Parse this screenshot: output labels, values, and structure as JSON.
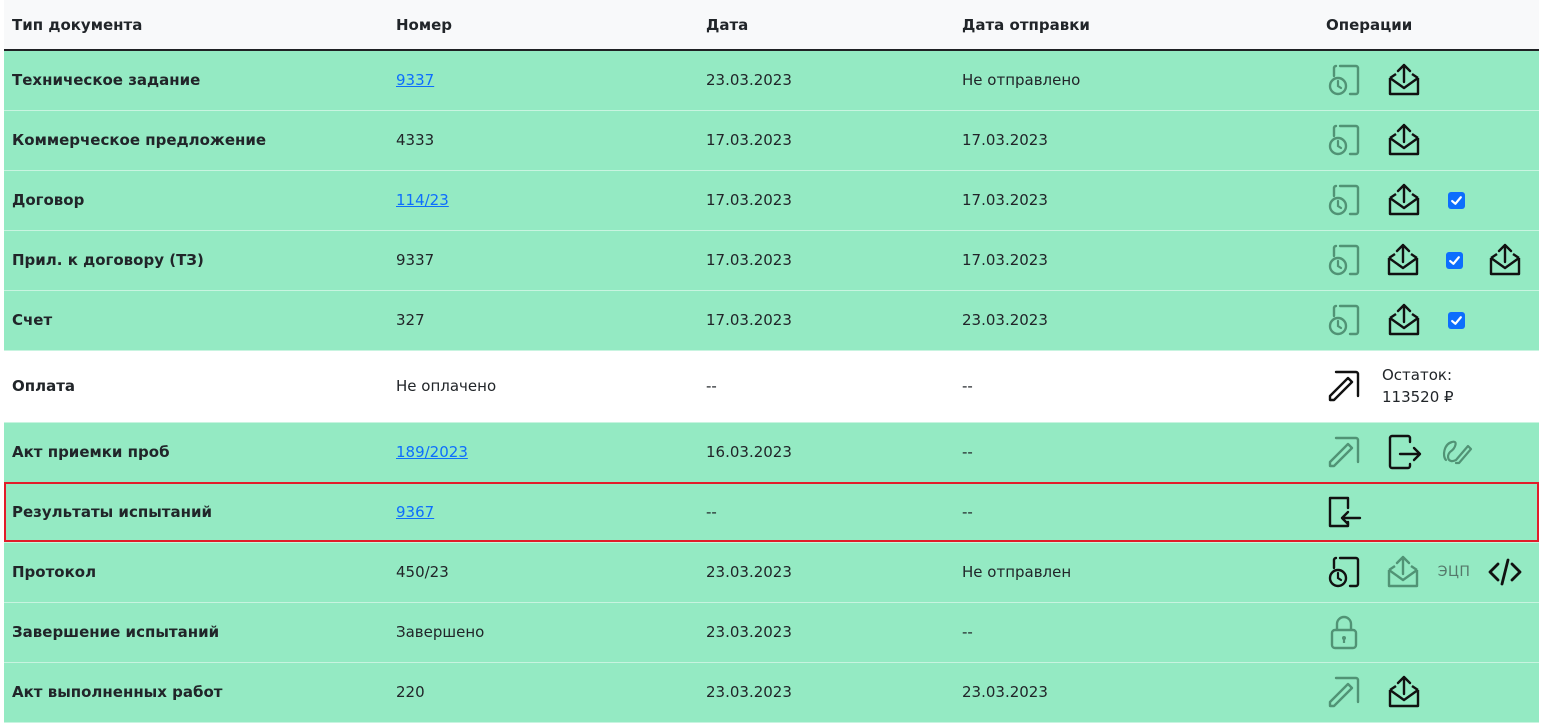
{
  "headers": {
    "type": "Тип документа",
    "number": "Номер",
    "date": "Дата",
    "sent": "Дата отправки",
    "ops": "Операции"
  },
  "rows": [
    {
      "type": "Техническое задание",
      "number": "9337",
      "date": "23.03.2023",
      "sent": "Не отправлено"
    },
    {
      "type": "Коммерческое предложение",
      "number": "4333",
      "date": "17.03.2023",
      "sent": "17.03.2023"
    },
    {
      "type": "Договор",
      "number": "114/23",
      "date": "17.03.2023",
      "sent": "17.03.2023"
    },
    {
      "type": "Прил. к договору (ТЗ)",
      "number": "9337",
      "date": "17.03.2023",
      "sent": "17.03.2023"
    },
    {
      "type": "Счет",
      "number": "327",
      "date": "17.03.2023",
      "sent": "23.03.2023"
    },
    {
      "type": "Оплата",
      "number": "Не оплачено",
      "date": "--",
      "sent": "--"
    },
    {
      "type": "Акт приемки проб",
      "number": "189/2023",
      "date": "16.03.2023",
      "sent": "--"
    },
    {
      "type": "Результаты испытаний",
      "number": "9367",
      "date": "--",
      "sent": "--"
    },
    {
      "type": "Протокол",
      "number": "450/23",
      "date": "23.03.2023",
      "sent": "Не отправлен"
    },
    {
      "type": "Завершение испытаний",
      "number": "Завершено",
      "date": "23.03.2023",
      "sent": "--"
    },
    {
      "type": "Акт выполненных работ",
      "number": "220",
      "date": "23.03.2023",
      "sent": "23.03.2023"
    }
  ],
  "payment": {
    "remainder_label": "Остаток:",
    "remainder_value": "113520 ₽"
  },
  "protocol": {
    "ecp_label": "ЭЦП"
  },
  "colors": {
    "row_green": "#94eac3",
    "link_blue": "#0d6efd",
    "highlight_red": "#e11d2a"
  }
}
